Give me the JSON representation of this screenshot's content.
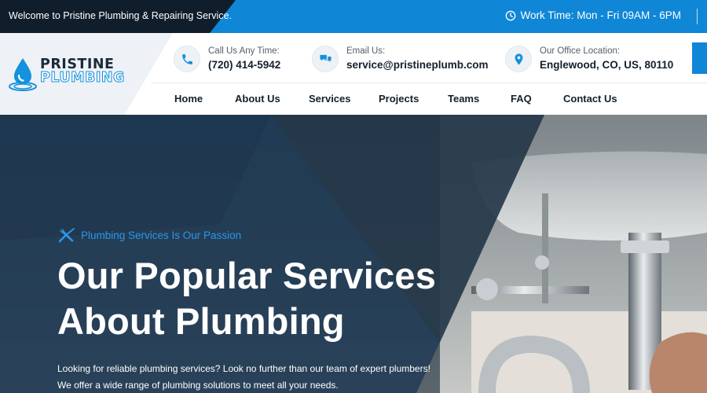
{
  "topbar": {
    "welcome": "Welcome to Pristine Plumbing & Repairing Service.",
    "work_time": "Work Time: Mon - Fri 09AM - 6PM"
  },
  "logo": {
    "line1": "PRISTINE",
    "line2": "PLUMBING"
  },
  "contacts": {
    "phone": {
      "label": "Call Us Any Time:",
      "value": "(720) 414-5942",
      "icon": "phone-icon"
    },
    "email": {
      "label": "Email Us:",
      "value": "service@pristineplumb.com",
      "icon": "chat-icon"
    },
    "office": {
      "label": "Our Office Location:",
      "value": "Englewood, CO, US, 80110",
      "icon": "location-pin-icon"
    }
  },
  "nav": {
    "items": [
      {
        "label": "Home"
      },
      {
        "label": "About Us"
      },
      {
        "label": "Services"
      },
      {
        "label": "Projects"
      },
      {
        "label": "Teams"
      },
      {
        "label": "FAQ"
      },
      {
        "label": "Contact Us"
      }
    ]
  },
  "hero": {
    "tagline": "Plumbing Services Is Our Passion",
    "title_line1": "Our Popular Services",
    "title_line2": "About Plumbing",
    "desc_line1": "Looking for reliable plumbing services? Look no further than our team of expert plumbers!",
    "desc_line2": "We offer a wide range of plumbing solutions to meet all your needs."
  },
  "colors": {
    "brand_blue": "#0f86d6",
    "dark_navy": "#101d2b",
    "accent_text": "#2a97e6"
  }
}
